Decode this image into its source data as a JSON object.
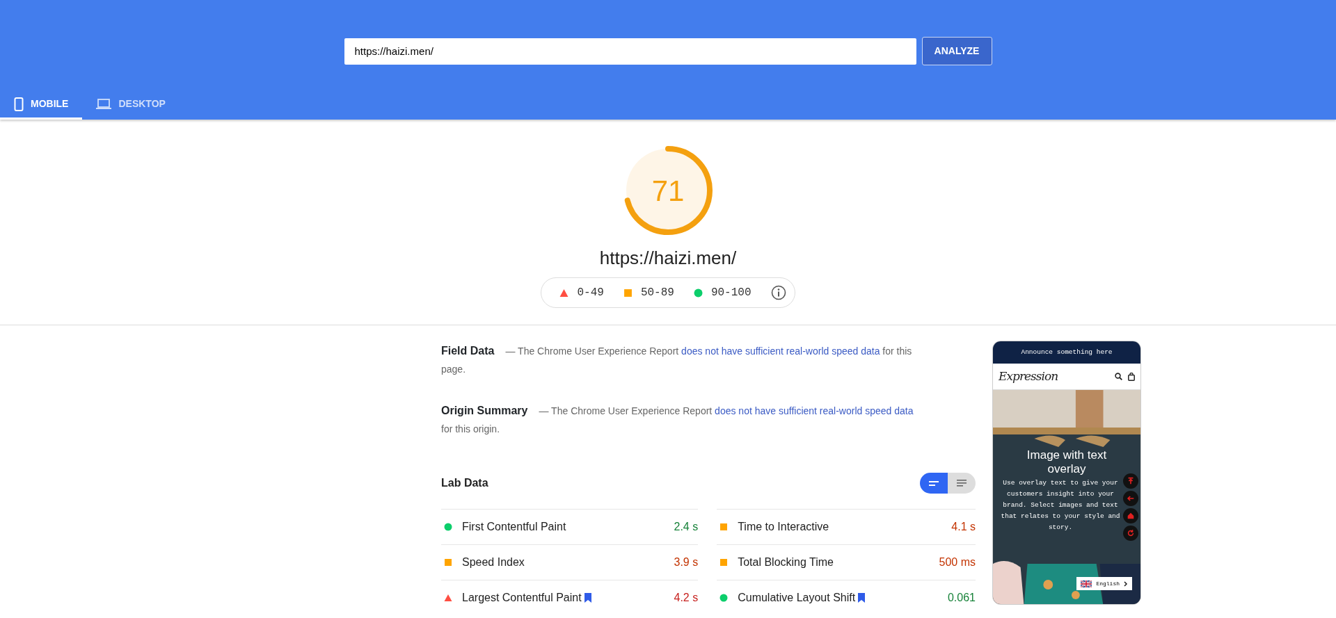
{
  "header": {
    "url_field": {
      "value": "https://haizi.men/"
    },
    "analyze_button": "ANALYZE"
  },
  "tabs": [
    {
      "label": "MOBILE",
      "kind": "mobile",
      "selected": true
    },
    {
      "label": "DESKTOP",
      "kind": "desktop",
      "selected": false
    }
  ],
  "score": {
    "value": "71",
    "level": 0.71,
    "kind": "average"
  },
  "tested_url": "https://haizi.men/",
  "legend": [
    {
      "kind": "poor",
      "label": "0-49"
    },
    {
      "kind": "average",
      "label": "50-89"
    },
    {
      "kind": "good",
      "label": "90-100"
    }
  ],
  "sections": [
    {
      "title": "Field Data",
      "text": "— The Chrome User Experience Report ",
      "link": "does not have sufficient real-world speed data",
      "text_end": " for this page."
    },
    {
      "title": "Origin Summary",
      "text": "— The Chrome User Experience Report ",
      "link": "does not have sufficient real-world speed data",
      "text_end": " for this origin."
    }
  ],
  "lab_data": {
    "title": "Lab Data",
    "view_toggle": [
      {
        "kind": "summary",
        "selected": true
      },
      {
        "kind": "list",
        "selected": false
      }
    ],
    "columns": [
      [
        {
          "name": "First Contentful Paint",
          "value": "2.4 s",
          "kind": "good",
          "flagged": false
        },
        {
          "name": "Speed Index",
          "value": "3.9 s",
          "kind": "average",
          "flagged": false
        },
        {
          "name": "Largest Contentful Paint",
          "value": "4.2 s",
          "kind": "poor",
          "flagged": true
        }
      ],
      [
        {
          "name": "Time to Interactive",
          "value": "4.1 s",
          "kind": "average",
          "flagged": false
        },
        {
          "name": "Total Blocking Time",
          "value": "500 ms",
          "kind": "average",
          "flagged": false
        },
        {
          "name": "Cumulative Layout Shift",
          "value": "0.061",
          "kind": "good",
          "flagged": true
        }
      ]
    ]
  },
  "preview": {
    "announcement": "Announce something here",
    "logo": "Expression",
    "heading": "Image with text overlay",
    "body": "Use overlay text to give your customers insight into your brand. Select images and text that relates to your style and story.",
    "language": "English"
  }
}
